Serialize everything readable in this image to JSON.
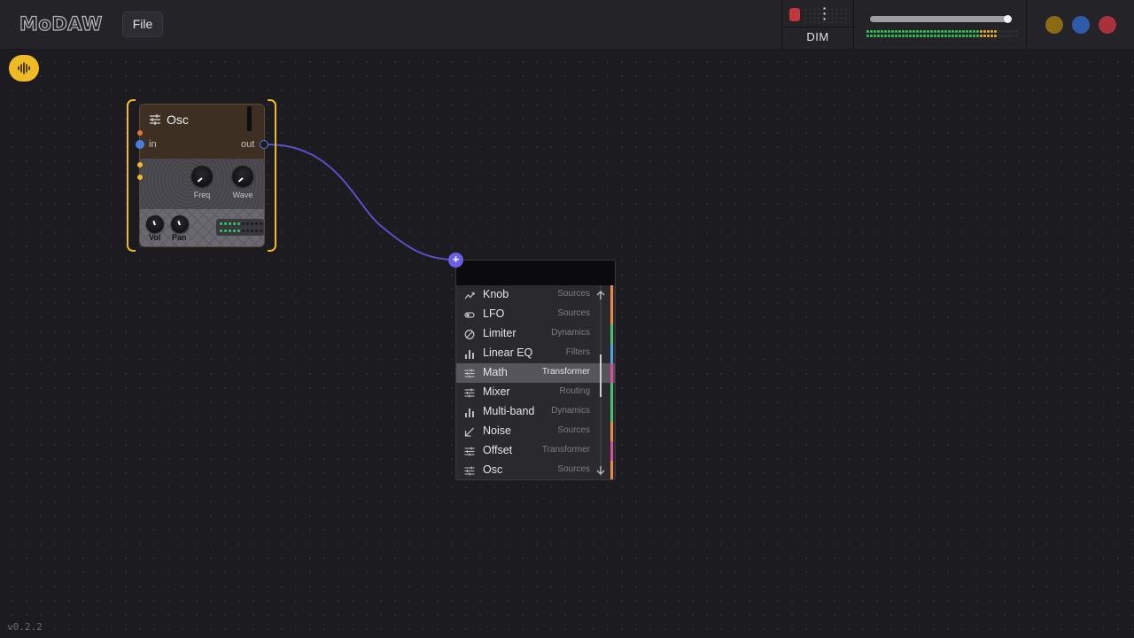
{
  "app": {
    "logo": "MoDAW",
    "version": "v0.2.2"
  },
  "toolbar": {
    "file_label": "File",
    "dim_label": "DIM",
    "master_volume": 0.98,
    "window_colors": [
      "#8a6a12",
      "#2f5aa8",
      "#a8313c"
    ]
  },
  "module": {
    "title": "Osc",
    "port_in": "in",
    "port_out": "out",
    "knobs": [
      "Freq",
      "Wave"
    ],
    "footer_knobs": [
      "Vol",
      "Pan"
    ],
    "header_color": "#3d2f22",
    "accent": "#f0ba24"
  },
  "menu": {
    "search_value": "",
    "items": [
      {
        "name": "Knob",
        "category": "Sources",
        "icon": "trend-up-icon",
        "stripe": "#e8894a"
      },
      {
        "name": "LFO",
        "category": "Sources",
        "icon": "toggle-icon",
        "stripe": "#e8894a"
      },
      {
        "name": "Limiter",
        "category": "Dynamics",
        "icon": "circle-slash-icon",
        "stripe": "#4cbf6c"
      },
      {
        "name": "Linear EQ",
        "category": "Filters",
        "icon": "bar-chart-icon",
        "stripe": "#4f9fd8"
      },
      {
        "name": "Math",
        "category": "Transformer",
        "icon": "sliders-icon",
        "stripe": "#d94fa0"
      },
      {
        "name": "Mixer",
        "category": "Routing",
        "icon": "sliders-icon",
        "stripe": "#4cbf6c"
      },
      {
        "name": "Multi-band",
        "category": "Dynamics",
        "icon": "bar-chart-icon",
        "stripe": "#4cbf6c"
      },
      {
        "name": "Noise",
        "category": "Sources",
        "icon": "arrow-down-left-icon",
        "stripe": "#e8894a"
      },
      {
        "name": "Offset",
        "category": "Transformer",
        "icon": "sliders-icon",
        "stripe": "#d94fa0"
      },
      {
        "name": "Osc",
        "category": "Sources",
        "icon": "sliders-icon",
        "stripe": "#e8894a"
      }
    ],
    "selected_index": 4
  }
}
